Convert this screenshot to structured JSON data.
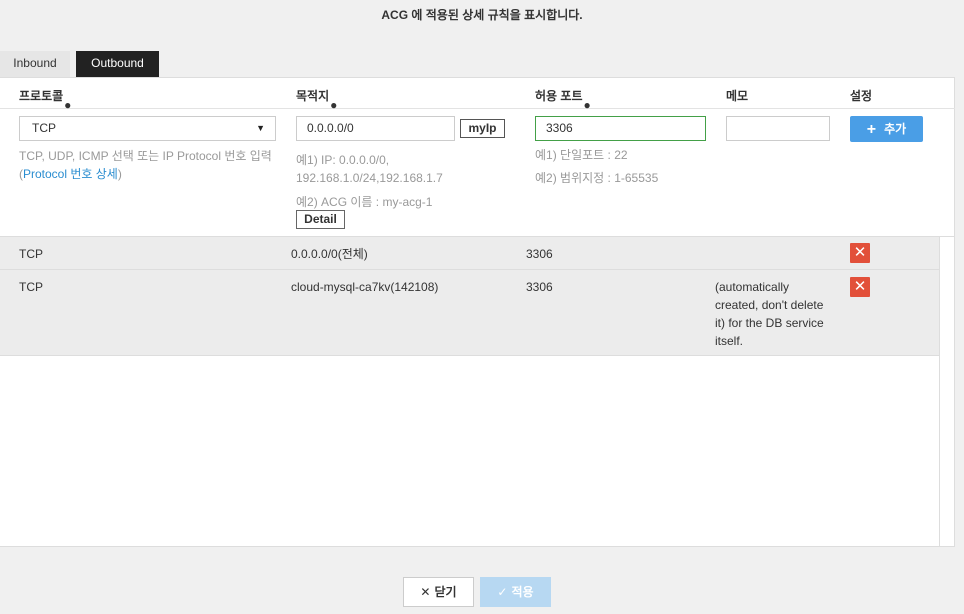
{
  "top_note": "ACG 에 적용된 상세 규칙을 표시합니다.",
  "tabs": [
    {
      "label": "Inbound",
      "active": false
    },
    {
      "label": "Outbound",
      "active": true
    }
  ],
  "headers": {
    "protocol": "프로토콜",
    "destination": "목적지",
    "port": "허용 포트",
    "memo": "메모",
    "settings": "설정",
    "required_mark": "●"
  },
  "form": {
    "protocol_value": "TCP",
    "protocol_hint_1": "TCP, UDP, ICMP 선택 또는 IP Protocol 번호 입력",
    "protocol_hint_open": "(",
    "protocol_link": "Protocol 번호 상세",
    "protocol_hint_close": ")",
    "destination_value": "0.0.0.0/0",
    "myip_label": "myIp",
    "dest_hint_1a": "예1) IP: 0.0.0.0/0,",
    "dest_hint_1b": "192.168.1.0/24,192.168.1.7",
    "dest_hint_2": "예2) ACG 이름 : my-acg-1",
    "detail_label": "Detail",
    "port_value": "3306",
    "port_hint_1": "예1) 단일포트 : 22",
    "port_hint_2": "예2) 범위지정 : 1-65535",
    "memo_value": "",
    "add_label": "추가"
  },
  "rules": [
    {
      "protocol": "TCP",
      "destination": "0.0.0.0/0(전체)",
      "port": "3306",
      "memo": ""
    },
    {
      "protocol": "TCP",
      "destination": "cloud-mysql-ca7kv(142108)",
      "port": "3306",
      "memo_lines": [
        "(automatically",
        "created, don't delete",
        "it) for the DB service",
        "itself."
      ]
    }
  ],
  "icons": {
    "delete": "close-icon",
    "add": "plus-icon",
    "dropdown": "caret-down-icon",
    "close": "x-icon",
    "apply": "check-icon"
  },
  "colors": {
    "accent": "#4a9ee6",
    "delete": "#e2503a",
    "active_tab": "#222222",
    "valid_border": "#43a047",
    "link": "#2a8dd0"
  },
  "footer": {
    "close_label": "닫기",
    "apply_label": "적용"
  }
}
